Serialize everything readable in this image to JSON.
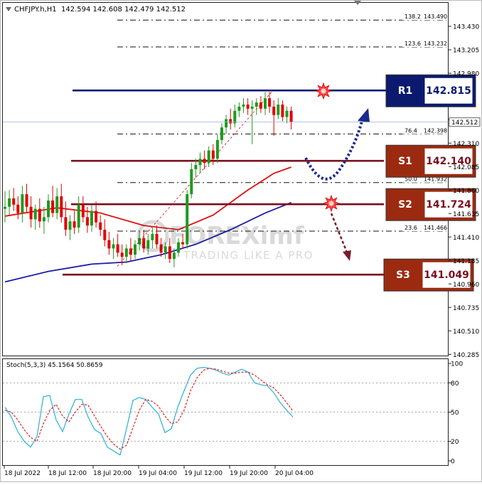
{
  "header": {
    "symbol_info": "CHFJPY.h,H1",
    "ohlc": "142.594 142.608 142.479 142.512"
  },
  "colors": {
    "bull": "#1f9a1f",
    "bear": "#e00000",
    "ma_fast": "#e01010",
    "ma_slow": "#1c1ca8",
    "resistance": "#0b1a6e",
    "support": "#7a0f1f",
    "s_box": "#9b2a10",
    "stoch_main": "#2ab0d4",
    "stoch_signal": "#e02020"
  },
  "watermark": {
    "brand": "FOREXimf",
    "tagline": "TRADING LIKE A PRO"
  },
  "price_axis": {
    "ticks": [
      "143.430",
      "143.205",
      "142.980",
      "142.535",
      "142.310",
      "142.085",
      "141.860",
      "141.635",
      "141.410",
      "141.185",
      "140.960",
      "140.735",
      "140.510",
      "140.285"
    ],
    "current_price": "142.512"
  },
  "fibonacci": [
    {
      "ratio": "138.2",
      "price": "143.490"
    },
    {
      "ratio": "123.6",
      "price": "143.232"
    },
    {
      "ratio": "76.4",
      "price": "142.398"
    },
    {
      "ratio": "50.0",
      "price": "141.932"
    },
    {
      "ratio": "23.6",
      "price": "141.466"
    }
  ],
  "levels": [
    {
      "label": "R1",
      "value": "142.815",
      "type": "resistance"
    },
    {
      "label": "S1",
      "value": "142.140",
      "type": "support"
    },
    {
      "label": "S2",
      "value": "141.724",
      "type": "support"
    },
    {
      "label": "S3",
      "value": "141.049",
      "type": "support"
    }
  ],
  "time_axis": [
    "18 Jul 2022",
    "18 Jul 12:00",
    "18 Jul 20:00",
    "19 Jul 04:00",
    "19 Jul 12:00",
    "19 Jul 20:00",
    "20 Jul 04:00"
  ],
  "stochastic": {
    "label": "Stoch(5,3,3) 45.1564 50.8659",
    "ticks": [
      "100",
      "80",
      "50",
      "20",
      "0"
    ]
  },
  "chart_data": [
    {
      "type": "candlestick",
      "title": "CHFJPY.h,H1",
      "ylim": [
        140.23,
        143.62
      ],
      "x": [
        "18 Jul 2022",
        "18 Jul 12:00",
        "18 Jul 20:00",
        "19 Jul 04:00",
        "19 Jul 12:00",
        "19 Jul 20:00",
        "20 Jul 04:00"
      ],
      "candles_ohlc": [
        [
          141.68,
          141.85,
          141.55,
          141.7
        ],
        [
          141.7,
          141.86,
          141.62,
          141.78
        ],
        [
          141.78,
          141.88,
          141.66,
          141.72
        ],
        [
          141.72,
          141.8,
          141.58,
          141.64
        ],
        [
          141.64,
          141.9,
          141.55,
          141.82
        ],
        [
          141.82,
          141.92,
          141.65,
          141.7
        ],
        [
          141.7,
          141.8,
          141.5,
          141.58
        ],
        [
          141.58,
          141.72,
          141.48,
          141.68
        ],
        [
          141.68,
          141.78,
          141.5,
          141.56
        ],
        [
          141.56,
          141.7,
          141.44,
          141.6
        ],
        [
          141.6,
          141.82,
          141.55,
          141.76
        ],
        [
          141.76,
          141.9,
          141.6,
          141.64
        ],
        [
          141.64,
          141.88,
          141.58,
          141.8
        ],
        [
          141.8,
          141.92,
          141.55,
          141.6
        ],
        [
          141.6,
          141.75,
          141.42,
          141.48
        ],
        [
          141.48,
          141.62,
          141.38,
          141.56
        ],
        [
          141.56,
          141.66,
          141.44,
          141.5
        ],
        [
          141.5,
          141.8,
          141.45,
          141.72
        ],
        [
          141.72,
          141.8,
          141.55,
          141.6
        ],
        [
          141.6,
          141.7,
          141.45,
          141.52
        ],
        [
          141.52,
          141.72,
          141.46,
          141.66
        ],
        [
          141.66,
          141.75,
          141.5,
          141.55
        ],
        [
          141.55,
          141.62,
          141.42,
          141.48
        ],
        [
          141.48,
          141.58,
          141.32,
          141.38
        ],
        [
          141.38,
          141.46,
          141.24,
          141.3
        ],
        [
          141.3,
          141.4,
          141.2,
          141.34
        ],
        [
          141.34,
          141.44,
          141.22,
          141.26
        ],
        [
          141.26,
          141.34,
          141.14,
          141.22
        ],
        [
          141.22,
          141.34,
          141.16,
          141.3
        ],
        [
          141.3,
          141.4,
          141.18,
          141.24
        ],
        [
          141.24,
          141.38,
          141.2,
          141.34
        ],
        [
          141.34,
          141.46,
          141.28,
          141.4
        ],
        [
          141.4,
          141.48,
          141.26,
          141.3
        ],
        [
          141.3,
          141.44,
          141.24,
          141.38
        ],
        [
          141.38,
          141.5,
          141.3,
          141.44
        ],
        [
          141.44,
          141.52,
          141.3,
          141.34
        ],
        [
          141.34,
          141.4,
          141.22,
          141.26
        ],
        [
          141.26,
          141.36,
          141.2,
          141.32
        ],
        [
          141.32,
          141.4,
          141.16,
          141.2
        ],
        [
          141.2,
          141.3,
          141.12,
          141.26
        ],
        [
          141.26,
          141.4,
          141.22,
          141.36
        ],
        [
          141.36,
          141.44,
          141.3,
          141.34
        ],
        [
          141.34,
          141.86,
          141.3,
          141.82
        ],
        [
          141.82,
          142.12,
          141.78,
          142.06
        ],
        [
          142.06,
          142.16,
          141.98,
          142.1
        ],
        [
          142.1,
          142.22,
          142.02,
          142.16
        ],
        [
          142.16,
          142.24,
          142.06,
          142.12
        ],
        [
          142.12,
          142.28,
          142.08,
          142.24
        ],
        [
          142.24,
          142.3,
          142.1,
          142.16
        ],
        [
          142.16,
          142.4,
          142.12,
          142.34
        ],
        [
          142.34,
          142.5,
          142.3,
          142.46
        ],
        [
          142.46,
          142.58,
          142.4,
          142.54
        ],
        [
          142.54,
          142.64,
          142.44,
          142.5
        ],
        [
          142.5,
          142.68,
          142.46,
          142.62
        ],
        [
          142.62,
          142.7,
          142.56,
          142.66
        ],
        [
          142.66,
          142.74,
          142.6,
          142.68
        ],
        [
          142.68,
          142.74,
          142.58,
          142.64
        ],
        [
          142.64,
          142.72,
          142.3,
          142.66
        ],
        [
          142.66,
          142.74,
          142.58,
          142.7
        ],
        [
          142.7,
          142.76,
          142.6,
          142.64
        ],
        [
          142.64,
          142.8,
          142.58,
          142.74
        ],
        [
          142.74,
          142.8,
          142.6,
          142.66
        ],
        [
          142.66,
          142.72,
          142.38,
          142.58
        ],
        [
          142.58,
          142.74,
          142.54,
          142.68
        ],
        [
          142.68,
          142.72,
          142.52,
          142.56
        ],
        [
          142.56,
          142.66,
          142.5,
          142.62
        ],
        [
          142.62,
          142.66,
          142.44,
          142.51
        ]
      ],
      "moving_averages": [
        {
          "name": "MA fast",
          "x_index": [
            0,
            12,
            22,
            32,
            40,
            48,
            56,
            62,
            66
          ],
          "values": [
            141.61,
            141.69,
            141.64,
            141.52,
            141.48,
            141.62,
            141.86,
            142.02,
            142.08
          ]
        },
        {
          "name": "MA slow",
          "x_index": [
            0,
            10,
            20,
            28,
            36,
            44,
            52,
            60,
            66
          ],
          "values": [
            140.98,
            141.08,
            141.15,
            141.17,
            141.24,
            141.34,
            141.48,
            141.64,
            141.74
          ]
        }
      ],
      "horizontal_levels": [
        {
          "label": "R1",
          "value": 142.815
        },
        {
          "label": "S1",
          "value": 142.14
        },
        {
          "label": "S2",
          "value": 141.724
        },
        {
          "label": "S3",
          "value": 141.049
        }
      ]
    },
    {
      "type": "line",
      "title": "Stoch(5,3,3) 45.1564 50.8659",
      "ylim": [
        0,
        100
      ],
      "series": [
        {
          "name": "main",
          "values": [
            55,
            45,
            30,
            20,
            14,
            25,
            66,
            67,
            42,
            30,
            48,
            63,
            63,
            45,
            32,
            28,
            14,
            10,
            6,
            33,
            62,
            65,
            63,
            55,
            48,
            29,
            33,
            55,
            72,
            88,
            95,
            96,
            95,
            93,
            90,
            88,
            91,
            94,
            91,
            80,
            78,
            77,
            70,
            60,
            52,
            45
          ]
        },
        {
          "name": "signal",
          "values": [
            52,
            50,
            42,
            32,
            24,
            20,
            38,
            52,
            58,
            46,
            40,
            50,
            58,
            57,
            46,
            35,
            25,
            17,
            12,
            16,
            34,
            52,
            63,
            61,
            56,
            46,
            38,
            40,
            52,
            72,
            85,
            93,
            95,
            94,
            92,
            90,
            90,
            91,
            91,
            88,
            83,
            78,
            75,
            68,
            60,
            51
          ]
        }
      ]
    }
  ]
}
